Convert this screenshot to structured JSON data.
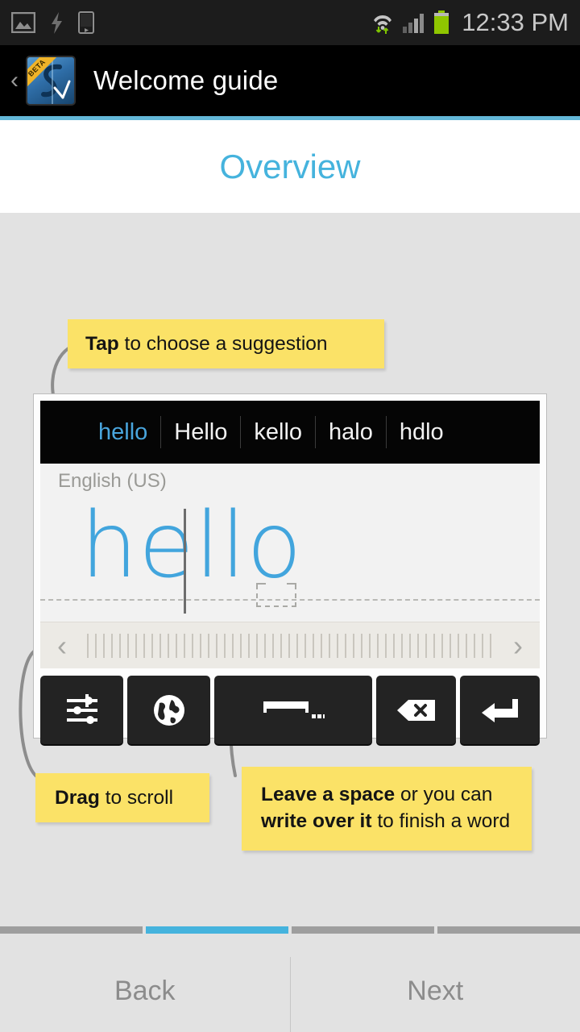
{
  "status_bar": {
    "time": "12:33 PM",
    "left_icons": [
      "image-icon",
      "lightning-bolt-icon",
      "media-device-icon"
    ],
    "right_icons": [
      "wifi-transfer-icon",
      "signal-bars-icon",
      "battery-icon"
    ],
    "battery_color": "#8fc600"
  },
  "action_bar": {
    "back_glyph": "‹",
    "app_icon_name": "app-icon-s",
    "badge": "BETA",
    "title": "Welcome guide"
  },
  "page": {
    "title": "Overview",
    "accent_color": "#45b3dd"
  },
  "callouts": [
    {
      "id": "tap",
      "bold_1": "Tap",
      "rest_1": " to choose a suggestion",
      "bg_color": "#fbe267"
    },
    {
      "id": "drag",
      "bold_1": "Drag",
      "rest_1": " to scroll",
      "bg_color": "#fbe267"
    },
    {
      "id": "space",
      "bold_1": "Leave a space",
      "rest_1": " or you can ",
      "bold_2": "write over it",
      "rest_2": " to finish a word",
      "bg_color": "#fbe267"
    }
  ],
  "keyboard": {
    "suggestions": [
      {
        "text": "hello",
        "selected": true
      },
      {
        "text": "Hello",
        "selected": false
      },
      {
        "text": "kello",
        "selected": false
      },
      {
        "text": "halo",
        "selected": false
      },
      {
        "text": "hdlo",
        "selected": false
      }
    ],
    "suggestion_active_color": "#49a5dd",
    "language_label": "English (US)",
    "handwriting_text": "hello",
    "ink_color": "#42a5dd",
    "space_placeholder_name": "space-placeholder-box",
    "scroll": {
      "left_chevron": "‹",
      "right_chevron": "›"
    },
    "keys": [
      {
        "name": "settings-sliders-key",
        "label": ""
      },
      {
        "name": "globe-language-key",
        "label": ""
      },
      {
        "name": "space-key",
        "label": ""
      },
      {
        "name": "backspace-key",
        "label": ""
      },
      {
        "name": "enter-return-key",
        "label": ""
      }
    ]
  },
  "footer": {
    "progress": {
      "total": 4,
      "current": 2
    },
    "back_label": "Back",
    "next_label": "Next"
  }
}
